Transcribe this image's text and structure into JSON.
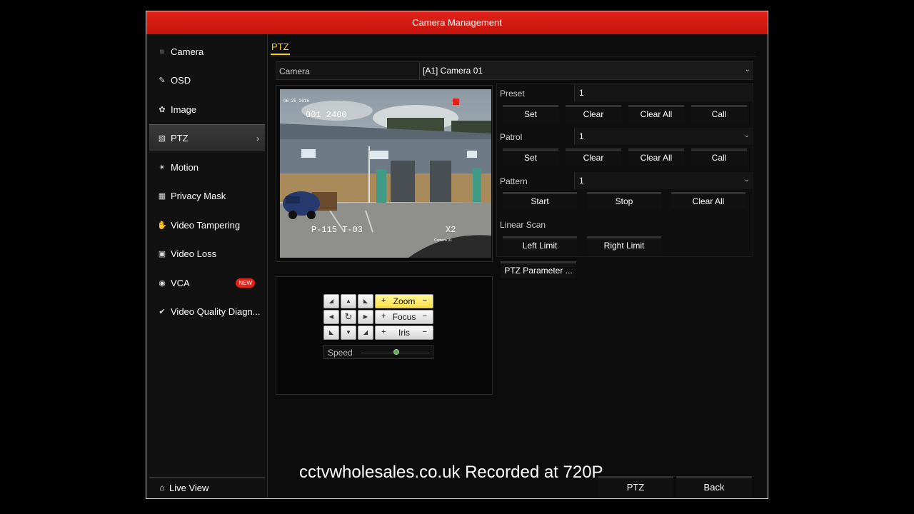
{
  "window": {
    "title": "Camera Management"
  },
  "sidebar": {
    "items": [
      {
        "label": "Camera",
        "icon": "camera-icon"
      },
      {
        "label": "OSD",
        "icon": "osd-icon"
      },
      {
        "label": "Image",
        "icon": "image-icon"
      },
      {
        "label": "PTZ",
        "icon": "ptz-icon",
        "active": true
      },
      {
        "label": "Motion",
        "icon": "motion-icon"
      },
      {
        "label": "Privacy Mask",
        "icon": "privacy-mask-icon"
      },
      {
        "label": "Video Tampering",
        "icon": "hand-icon"
      },
      {
        "label": "Video Loss",
        "icon": "video-loss-icon"
      },
      {
        "label": "VCA",
        "icon": "vca-icon",
        "badge": "NEW"
      },
      {
        "label": "Video Quality Diagn...",
        "icon": "diagnosis-icon"
      }
    ],
    "live_view": "Live View"
  },
  "tab": {
    "label": "PTZ"
  },
  "camera": {
    "label": "Camera",
    "value": "[A1] Camera 01"
  },
  "preview": {
    "osd_date": "06-25-2018",
    "osd_pos": "001 2400",
    "osd_pt": "P-115 T-03",
    "osd_zoom": "X2",
    "osd_cam": "Camera 01"
  },
  "ptz": {
    "preset": {
      "label": "Preset",
      "value": "1",
      "buttons": [
        "Set",
        "Clear",
        "Clear All",
        "Call"
      ]
    },
    "patrol": {
      "label": "Patrol",
      "value": "1",
      "buttons": [
        "Set",
        "Clear",
        "Clear All",
        "Call"
      ]
    },
    "pattern": {
      "label": "Pattern",
      "value": "1",
      "buttons": [
        "Start",
        "Stop",
        "Clear All"
      ]
    },
    "linear_scan": {
      "label": "Linear Scan",
      "buttons": [
        "Left Limit",
        "Right Limit"
      ]
    },
    "param_button": "PTZ Parameter ..."
  },
  "lens": {
    "zoom": "Zoom",
    "focus": "Focus",
    "iris": "Iris",
    "plus": "+",
    "minus": "−",
    "speed": "Speed",
    "speed_level": 0.5
  },
  "footer": {
    "watermark": "cctvwholesales.co.uk Recorded at 720P",
    "ptz_button": "PTZ",
    "back_button": "Back"
  },
  "colors": {
    "title_bar": "#d81e15",
    "tab_accent": "#ffd400",
    "zoom_highlight": "#ffe14a",
    "badge": "#e2231a"
  }
}
